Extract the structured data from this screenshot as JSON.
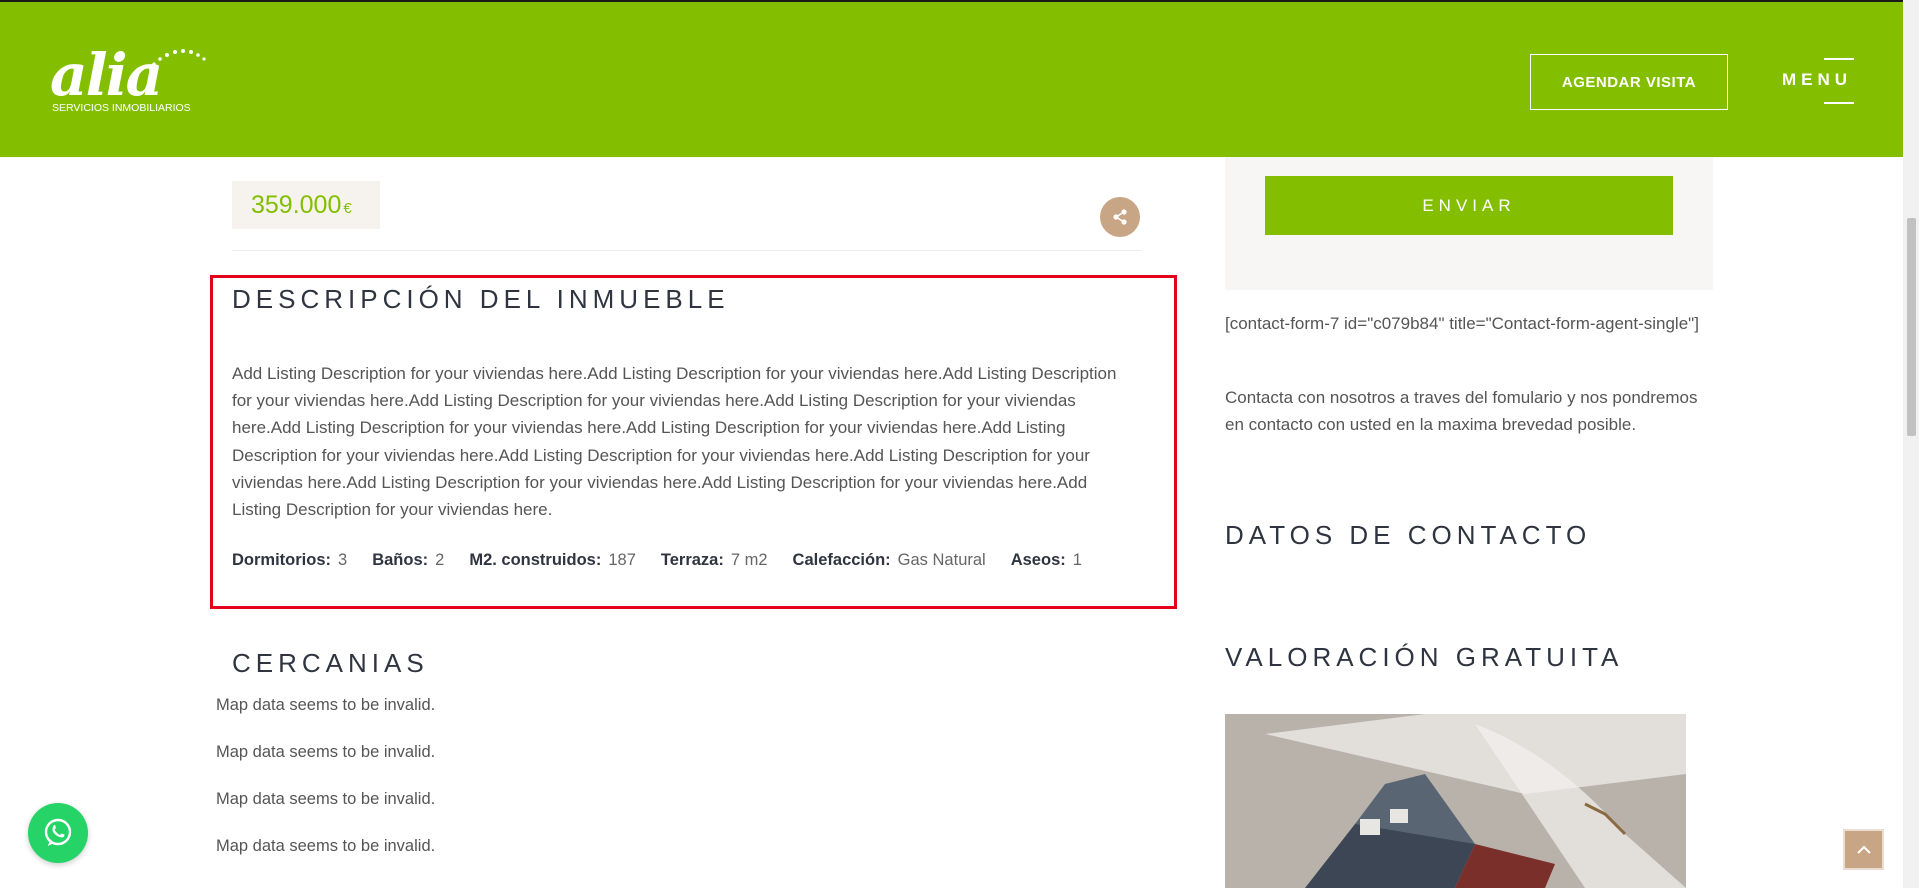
{
  "header": {
    "logo_word": "alia",
    "logo_sub": "SERVICIOS INMOBILIARIOS",
    "cta_label": "AGENDAR VISITA",
    "menu_label": "MENU"
  },
  "listing": {
    "price_value": "359.000",
    "price_currency": "€",
    "description_title": "DESCRIPCIÓN DEL INMUEBLE",
    "description_text": "Add Listing Description for your viviendas here.Add Listing Description for your viviendas here.Add Listing Description for your viviendas here.Add Listing Description for your viviendas here.Add Listing Description for your viviendas here.Add Listing Description for your viviendas here.Add Listing Description for your viviendas here.Add Listing Description for your viviendas here.Add Listing Description for your viviendas here.Add Listing Description for your viviendas here.Add Listing Description for your viviendas here.Add Listing Description for your viviendas here.Add Listing Description for your viviendas here.",
    "features": [
      {
        "label": "Dormitorios",
        "value": "3"
      },
      {
        "label": "Baños",
        "value": "2"
      },
      {
        "label": "M2. construidos",
        "value": "187"
      },
      {
        "label": "Terraza",
        "value": "7 m2"
      },
      {
        "label": "Calefacción",
        "value": "Gas Natural"
      },
      {
        "label": "Aseos",
        "value": "1"
      }
    ],
    "nearby_title": "CERCANIAS",
    "map_messages": [
      "Map data seems to be invalid.",
      "Map data seems to be invalid.",
      "Map data seems to be invalid.",
      "Map data seems to be invalid."
    ]
  },
  "sidebar": {
    "send_label": "ENVIAR",
    "shortcode_text": "[contact-form-7 id=\"c079b84\" title=\"Contact-form-agent-single\"]",
    "contact_text": "Contacta con nosotros a traves del fomulario y nos pondremos en contacto con usted en la maxima brevedad posible.",
    "contact_title": "DATOS DE CONTACTO",
    "valuation_title": "VALORACIÓN GRATUITA"
  },
  "icons": {
    "share": "share-icon",
    "whatsapp": "whatsapp-icon",
    "back_to_top": "chevron-up-icon"
  },
  "colors": {
    "brand_green": "#83bf00",
    "accent_tan": "#c8a585",
    "highlight_red": "#e2001a",
    "heading": "#2f3540"
  }
}
